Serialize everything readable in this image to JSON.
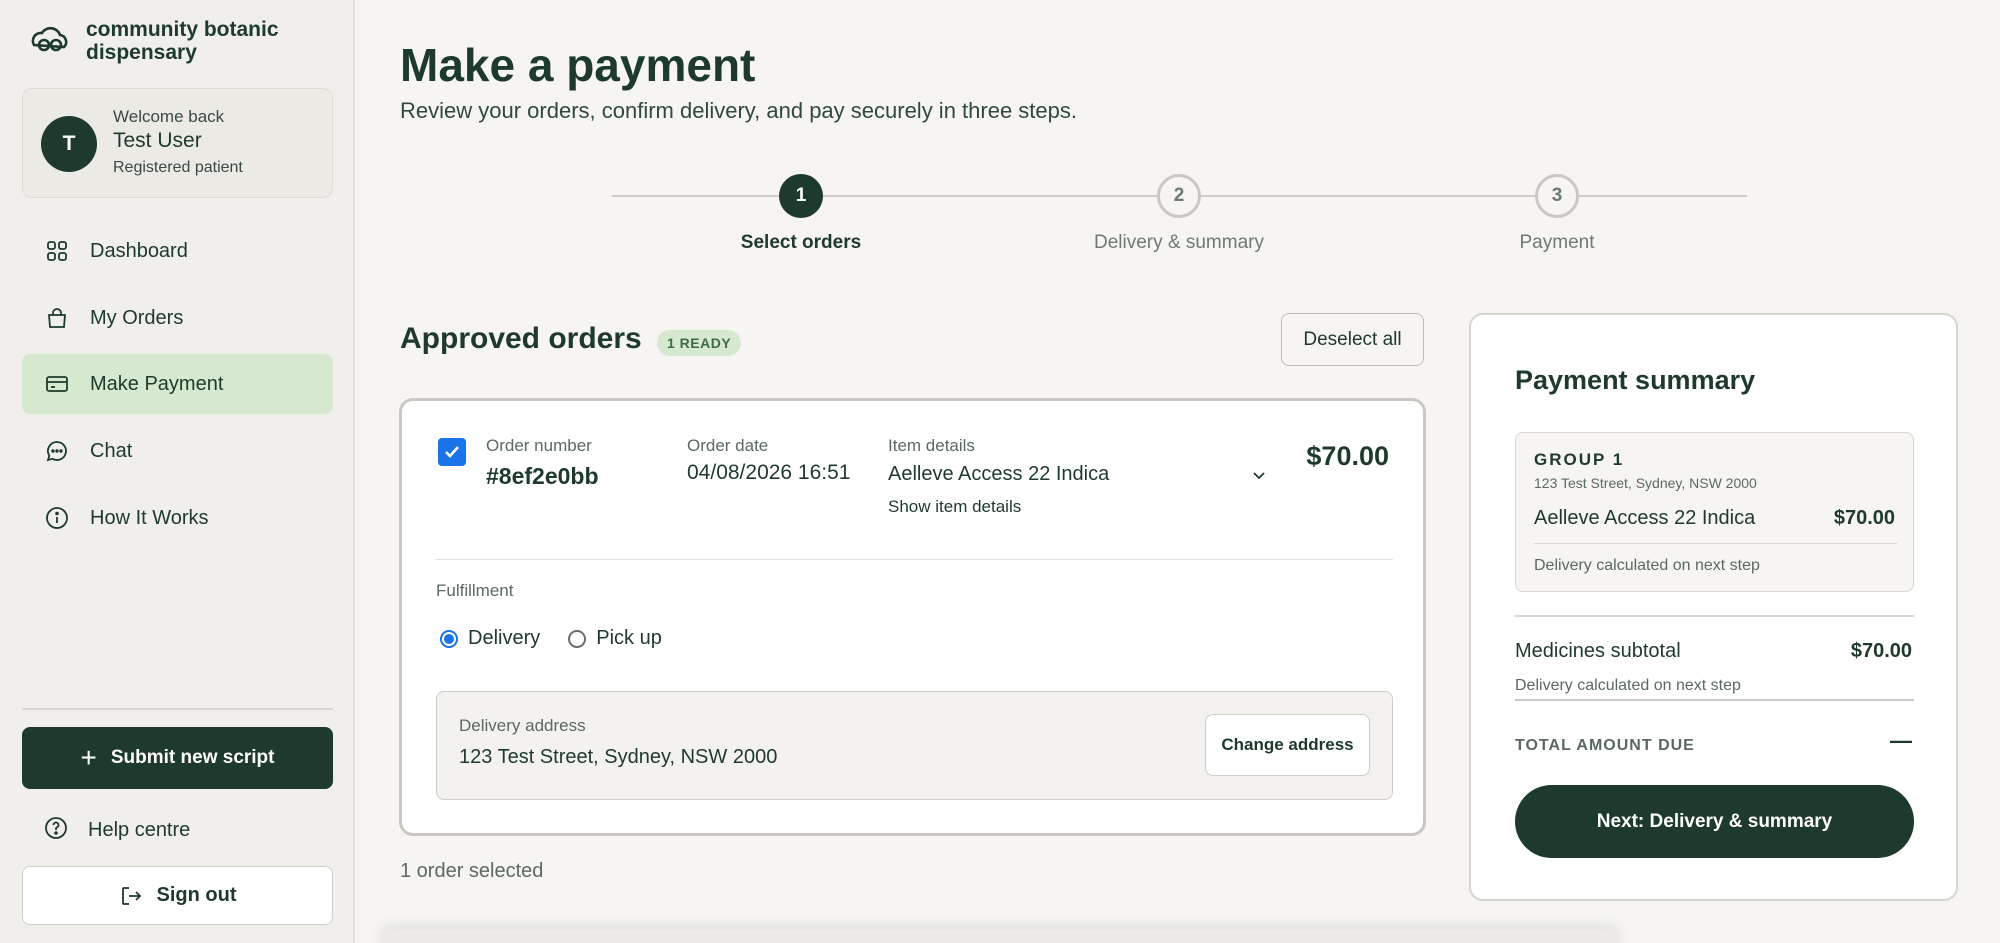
{
  "brand": {
    "name": "community botanic dispensary"
  },
  "user": {
    "initial": "T",
    "welcome": "Welcome back",
    "name": "Test User",
    "role": "Registered patient"
  },
  "nav": {
    "items": [
      {
        "label": "Dashboard",
        "icon": "grid-icon"
      },
      {
        "label": "My Orders",
        "icon": "bag-icon"
      },
      {
        "label": "Make Payment",
        "icon": "card-icon",
        "active": true
      },
      {
        "label": "Chat",
        "icon": "chat-icon"
      },
      {
        "label": "How It Works",
        "icon": "info-icon"
      }
    ],
    "submit_label": "Submit new script",
    "help_label": "Help centre",
    "signout_label": "Sign out"
  },
  "header": {
    "title": "Make a payment",
    "subtitle": "Review your orders, confirm delivery, and pay securely in three steps."
  },
  "stepper": {
    "steps": [
      {
        "number": "1",
        "label": "Select orders",
        "state": "active"
      },
      {
        "number": "2",
        "label": "Delivery & summary",
        "state": "inactive"
      },
      {
        "number": "3",
        "label": "Payment",
        "state": "inactive"
      }
    ]
  },
  "orders": {
    "title": "Approved orders",
    "badge": "1 READY",
    "deselect_label": "Deselect all",
    "selected_text": "1 order selected",
    "items": [
      {
        "checked": true,
        "order_number_label": "Order number",
        "order_number": "#8ef2e0bb",
        "order_date_label": "Order date",
        "order_date": "04/08/2026 16:51",
        "item_details_label": "Item details",
        "item_name": "Aelleve Access 22 Indica",
        "show_details": "Show item details",
        "price": "$70.00",
        "fulfillment_label": "Fulfillment",
        "fulfillment_options": [
          "Delivery",
          "Pick up"
        ],
        "fulfillment_selected": "Delivery",
        "address_label": "Delivery address",
        "address": "123 Test Street, Sydney, NSW 2000",
        "change_address_label": "Change address"
      }
    ]
  },
  "summary": {
    "title": "Payment summary",
    "group": {
      "title": "GROUP 1",
      "address": "123 Test Street, Sydney, NSW 2000",
      "item": "Aelleve Access 22 Indica",
      "price": "$70.00",
      "note": "Delivery calculated on next step"
    },
    "subtotal_label": "Medicines subtotal",
    "subtotal_value": "$70.00",
    "subtotal_note": "Delivery calculated on next step",
    "total_label": "TOTAL AMOUNT DUE",
    "total_value": "—",
    "next_label": "Next: Delivery & summary"
  },
  "colors": {
    "primary": "#1d3a2c",
    "active_nav": "#d6e8cf",
    "checkbox": "#1a73e8"
  }
}
